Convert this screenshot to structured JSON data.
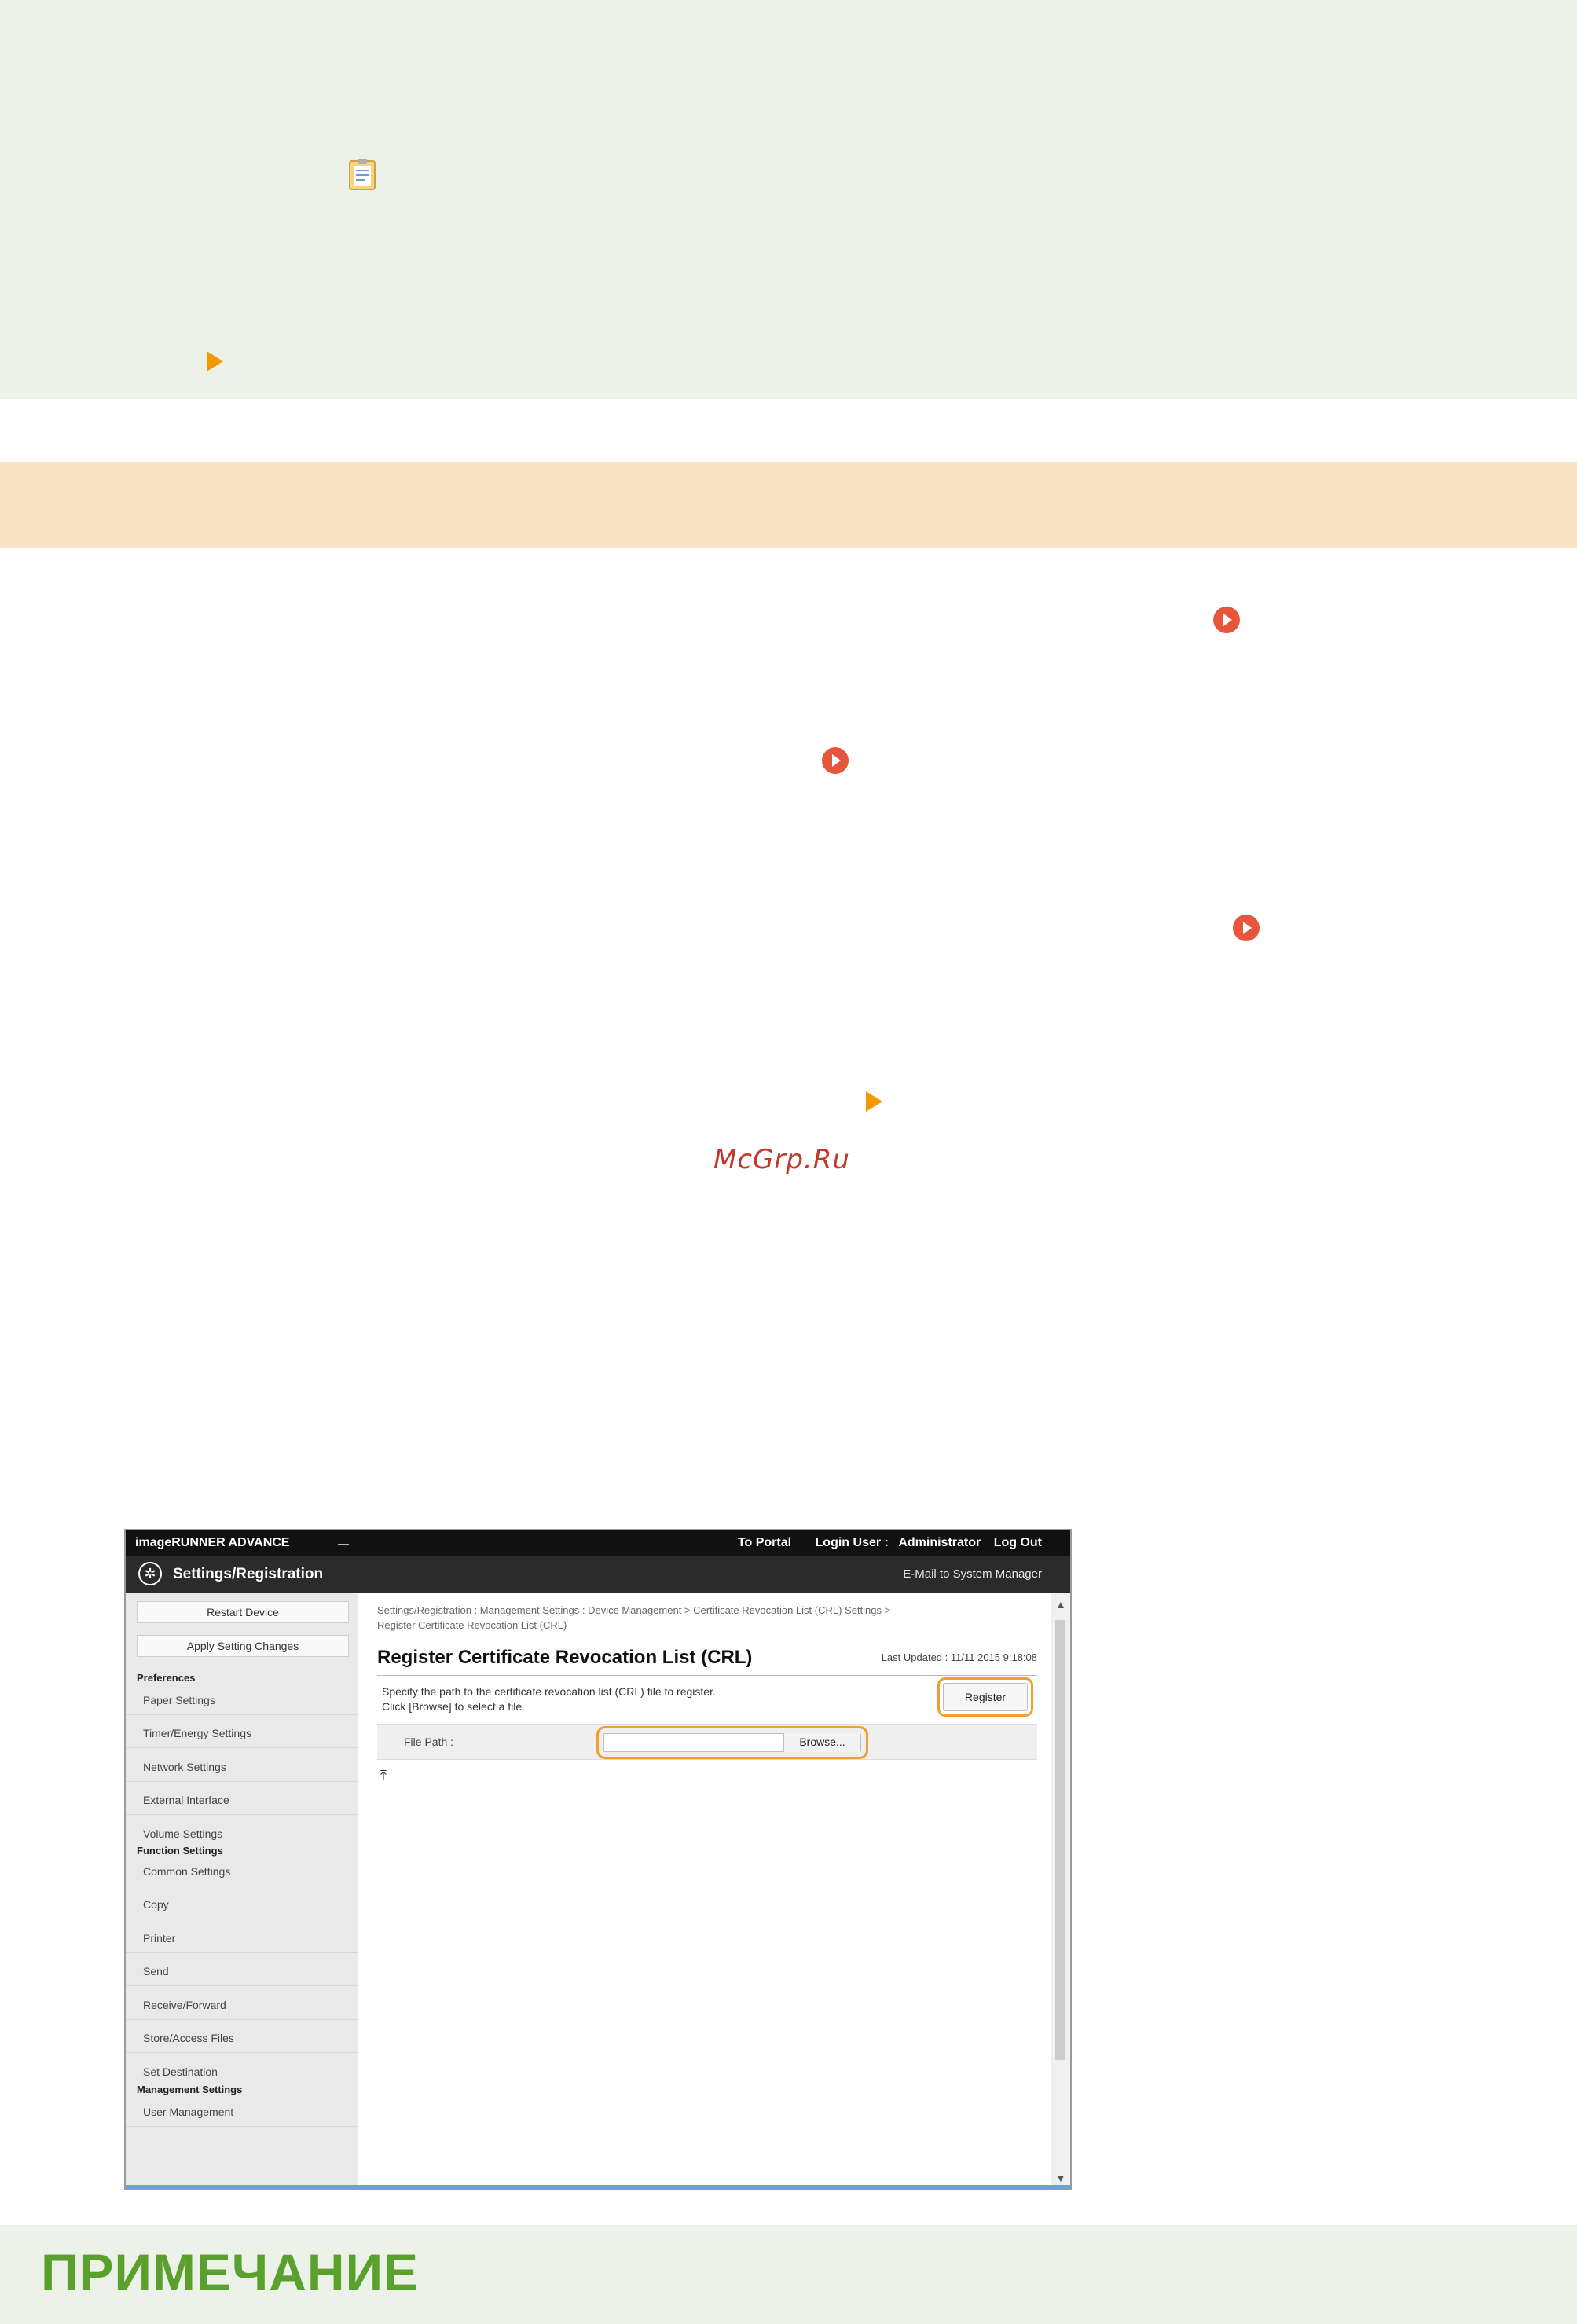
{
  "watermark": "McGrp.Ru",
  "note_heading": "ПРИМЕЧАНИЕ",
  "colors": {
    "note_bg": "#ecf2e8",
    "heading_band": "#fbe4c5",
    "accent_orange": "#f39800",
    "link_red": "#e8553d",
    "note_green": "#5aa02c",
    "highlight": "#f0a030"
  },
  "screenshot": {
    "product": "imageRUNNER ADVANCE",
    "model": "—",
    "top_links": [
      "To Portal",
      "Login User :",
      "Administrator",
      "Log Out"
    ],
    "app_title": "Settings/Registration",
    "email_link": "E-Mail to System Manager",
    "sidebar": {
      "restart_label": "Restart Device",
      "apply_label": "Apply Setting Changes",
      "groups": [
        {
          "label": "Preferences",
          "items": [
            "Paper Settings",
            "Timer/Energy Settings",
            "Network Settings",
            "External Interface",
            "Volume Settings"
          ]
        },
        {
          "label": "Function Settings",
          "items": [
            "Common Settings",
            "Copy",
            "Printer",
            "Send",
            "Receive/Forward",
            "Store/Access Files",
            "Set Destination"
          ]
        },
        {
          "label": "Management Settings",
          "items": [
            "User Management"
          ]
        }
      ]
    },
    "breadcrumb_line1": "Settings/Registration : Management Settings : Device Management > Certificate Revocation List (CRL) Settings >",
    "breadcrumb_line2": "Register Certificate Revocation List (CRL)",
    "page_title": "Register Certificate Revocation List (CRL)",
    "last_updated": "Last Updated : 11/11 2015 9:18:08",
    "description_line1": "Specify the path to the certificate revocation list (CRL) file to register.",
    "description_line2": "Click [Browse] to select a file.",
    "register_label": "Register",
    "file_path_label": "File Path :",
    "file_path_value": "",
    "browse_label": "Browse..."
  }
}
